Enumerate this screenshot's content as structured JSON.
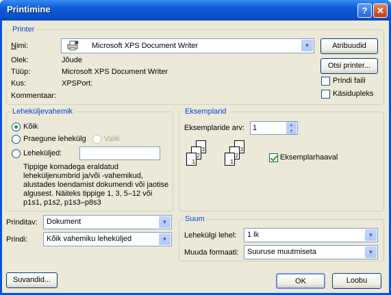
{
  "window": {
    "title": "Printimine"
  },
  "printer_group": {
    "title": "Printer",
    "name_label": "Nimi:",
    "name_value": "Microsoft XPS Document Writer",
    "status_label": "Olek:",
    "status_value": "Jõude",
    "type_label": "Tüüp:",
    "type_value": "Microsoft XPS Document Writer",
    "where_label": "Kus:",
    "where_value": "XPSPort:",
    "comment_label": "Kommentaar:",
    "properties_button": "Atribuudid",
    "find_printer_button": "Otsi printer...",
    "print_to_file_label": "Prindi faili",
    "print_to_file_checked": false,
    "manual_duplex_label": "Käsidupleks",
    "manual_duplex_checked": false
  },
  "page_range": {
    "title": "Leheküljevahemik",
    "all_label": "Kõik",
    "current_page_label": "Praegune lehekülg",
    "selection_label": "Valik",
    "pages_label": "Leheküljed:",
    "pages_value": "",
    "help_lines": [
      "Tippige komadega eraldatud",
      "leheküljenumbrid ja/või -vahemikud,",
      "alustades loendamist dokumendi või jaotise",
      "algusest. Näiteks tippige 1, 3, 5–12 või",
      "p1s1, p1s2, p1s3–p8s3"
    ]
  },
  "copies": {
    "title": "Eksemplarid",
    "count_label": "Eksemplaride arv:",
    "count_value": "1",
    "collate_label": "Eksemplarhaaval",
    "collate_checked": true,
    "page_digits": [
      "3",
      "2",
      "1"
    ]
  },
  "print_what": {
    "what_label": "Prinditav:",
    "what_value": "Dokument",
    "print_label": "Prindi:",
    "print_value": "Kõik vahemiku leheküljed"
  },
  "zoom": {
    "title": "Suum",
    "pages_per_sheet_label": "Lehekülgi lehel:",
    "pages_per_sheet_value": "1 lk",
    "scale_label": "Muuda formaati:",
    "scale_value": "Suuruse muutmiseta"
  },
  "footer": {
    "options_button": "Suvandid...",
    "ok_button": "OK",
    "cancel_button": "Loobu"
  }
}
